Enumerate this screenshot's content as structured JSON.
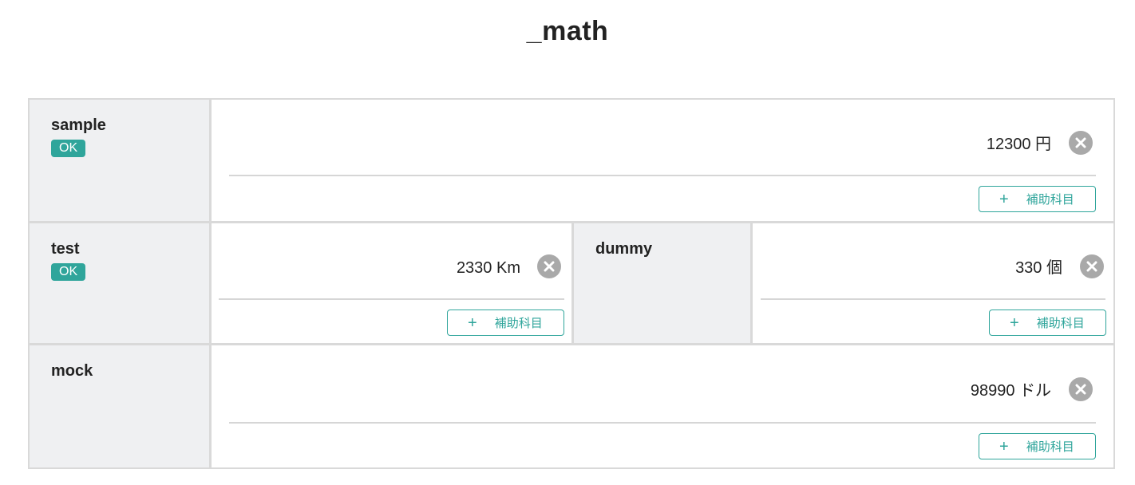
{
  "page": {
    "title": "_math"
  },
  "rows": [
    {
      "items": [
        {
          "label": "sample",
          "badge": "OK",
          "value": "12300 円",
          "sub_button": "補助科目",
          "sub_plus": "+"
        }
      ]
    },
    {
      "items": [
        {
          "label": "test",
          "badge": "OK",
          "value": "2330 Km",
          "sub_button": "補助科目",
          "sub_plus": "+"
        },
        {
          "label": "dummy",
          "value": "330 個",
          "sub_button": "補助科目",
          "sub_plus": "+"
        }
      ]
    },
    {
      "items": [
        {
          "label": "mock",
          "value": "98990 ドル",
          "sub_button": "補助科目",
          "sub_plus": "+"
        }
      ]
    }
  ],
  "colors": {
    "accent": "#2fa59b",
    "label_bg": "#eff0f2",
    "border": "#d9d9d9",
    "clear_icon": "#a9a9a9"
  },
  "icons": {
    "clear": "close-circle-icon",
    "add": "plus-icon"
  }
}
